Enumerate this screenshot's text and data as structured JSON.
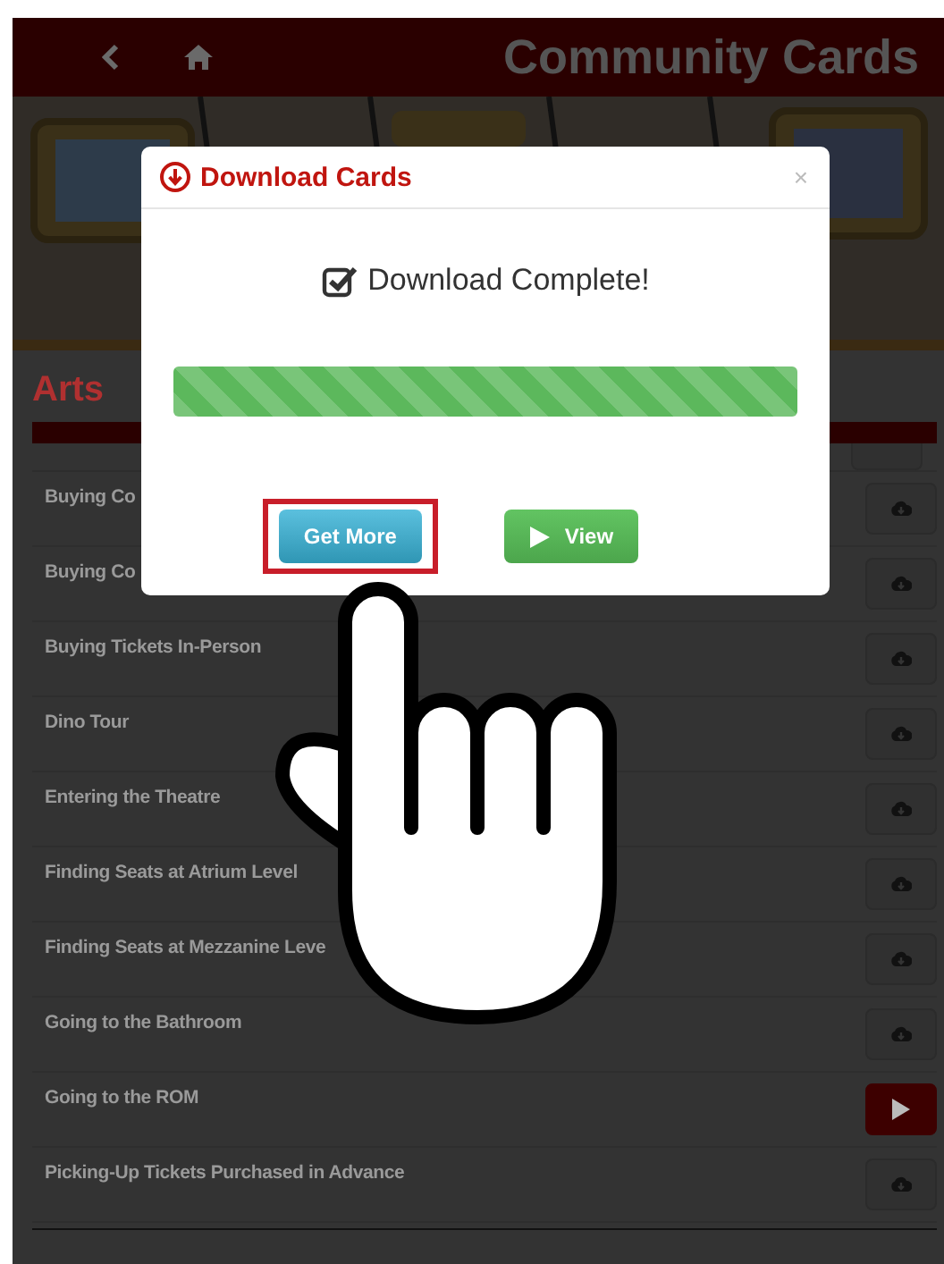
{
  "header": {
    "title": "Community Cards"
  },
  "section": {
    "title": "Arts"
  },
  "rows": [
    {
      "title": "Buying Co",
      "kind": "download"
    },
    {
      "title": "Buying Co",
      "kind": "download"
    },
    {
      "title": "Buying Tickets In-Person",
      "kind": "download"
    },
    {
      "title": "Dino Tour",
      "kind": "download"
    },
    {
      "title": "Entering the Theatre",
      "kind": "download"
    },
    {
      "title": "Finding Seats at Atrium Level",
      "kind": "download"
    },
    {
      "title": "Finding Seats at Mezzanine Leve",
      "kind": "download"
    },
    {
      "title": "Going to the Bathroom",
      "kind": "download"
    },
    {
      "title": "Going to the ROM",
      "kind": "play"
    },
    {
      "title": "Picking-Up Tickets Purchased in Advance",
      "kind": "download"
    }
  ],
  "dialog": {
    "title": "Download Cards",
    "close": "×",
    "message": "Download Complete!",
    "checked": true,
    "level": 1,
    "buttons": [
      {
        "label": "Get More",
        "kind": "primary",
        "highlighted": true
      },
      {
        "label": "View",
        "kind": "success",
        "highlighted": false
      }
    ]
  }
}
